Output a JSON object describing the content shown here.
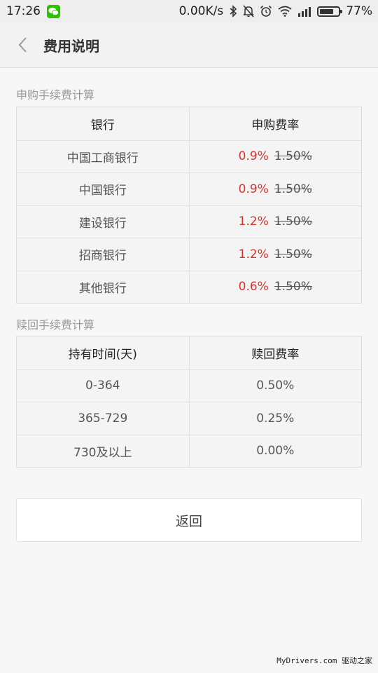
{
  "status_bar": {
    "time": "17:26",
    "net_speed": "0.00K/s",
    "battery_percent": "77%",
    "battery_level": 0.77,
    "icons": [
      "wechat-icon",
      "bluetooth-icon",
      "mute-icon",
      "alarm-icon",
      "wifi-icon",
      "signal-icon",
      "battery-icon"
    ]
  },
  "header": {
    "title": "费用说明"
  },
  "purchase": {
    "section_title": "申购手续费计算",
    "columns": [
      "银行",
      "申购费率"
    ],
    "rows": [
      {
        "bank": "中国工商银行",
        "rate": "0.9%",
        "original": "1.50%"
      },
      {
        "bank": "中国银行",
        "rate": "0.9%",
        "original": "1.50%"
      },
      {
        "bank": "建设银行",
        "rate": "1.2%",
        "original": "1.50%"
      },
      {
        "bank": "招商银行",
        "rate": "1.2%",
        "original": "1.50%"
      },
      {
        "bank": "其他银行",
        "rate": "0.6%",
        "original": "1.50%"
      }
    ]
  },
  "redemption": {
    "section_title": "赎回手续费计算",
    "columns": [
      "持有时间(天)",
      "赎回费率"
    ],
    "rows": [
      {
        "period": "0-364",
        "rate": "0.50%"
      },
      {
        "period": "365-729",
        "rate": "0.25%"
      },
      {
        "period": "730及以上",
        "rate": "0.00%"
      }
    ]
  },
  "return_button": "返回",
  "watermark": "MyDrivers.com 驱动之家",
  "colors": {
    "discount_red": "#d9312b",
    "wechat_green": "#2dc100"
  }
}
